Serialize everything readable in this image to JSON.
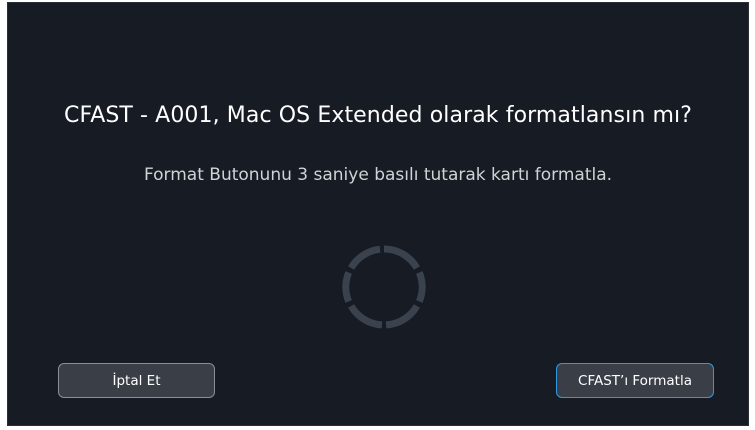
{
  "dialog": {
    "title": "CFAST - A001, Mac OS Extended olarak formatlansın mı?",
    "instruction": "Format Butonunu 3 saniye basılı tutarak kartı formatla.",
    "spinner_icon": "loading-ring-icon",
    "colors": {
      "background": "#171c24",
      "button_fill": "#3a3f47",
      "cancel_border": "#8a8f96",
      "format_border": "#2f9ae0",
      "spinner": "#3a424d"
    }
  },
  "buttons": {
    "cancel_label": "İptal Et",
    "format_label": "CFAST’ı Formatla"
  }
}
